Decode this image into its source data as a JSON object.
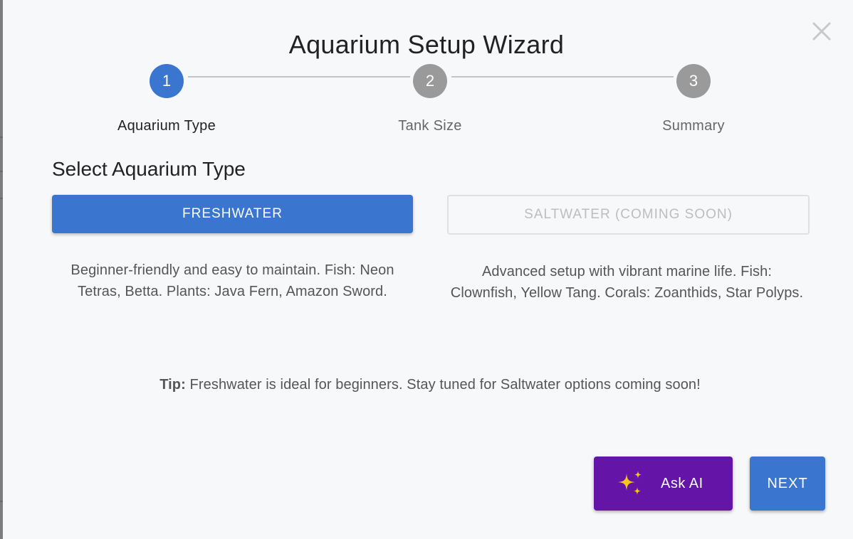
{
  "dialog": {
    "title": "Aquarium Setup Wizard",
    "close_icon": "close-icon"
  },
  "stepper": {
    "steps": [
      {
        "number": "1",
        "label": "Aquarium Type",
        "state": "active"
      },
      {
        "number": "2",
        "label": "Tank Size",
        "state": "inactive"
      },
      {
        "number": "3",
        "label": "Summary",
        "state": "inactive"
      }
    ]
  },
  "section": {
    "heading": "Select Aquarium Type"
  },
  "options": {
    "freshwater": {
      "label": "FRESHWATER",
      "description": "Beginner-friendly and easy to maintain. Fish: Neon Tetras, Betta. Plants: Java Fern, Amazon Sword.",
      "selected": true
    },
    "saltwater": {
      "label": "SALTWATER (COMING SOON)",
      "description": "Advanced setup with vibrant marine life. Fish: Clownfish, Yellow Tang. Corals: Zoanthids, Star Polyps.",
      "disabled": true
    }
  },
  "tip": {
    "prefix": "Tip:",
    "text": " Freshwater is ideal for beginners. Stay tuned for Saltwater options coming soon!"
  },
  "actions": {
    "ask_ai_label": "Ask AI",
    "ask_ai_icon": "sparkles-icon",
    "next_label": "NEXT"
  },
  "colors": {
    "primary": "#3a76d0",
    "ai_purple": "#6414a6",
    "sparkle_yellow": "#f5c518",
    "step_inactive": "#9a9a9a"
  }
}
